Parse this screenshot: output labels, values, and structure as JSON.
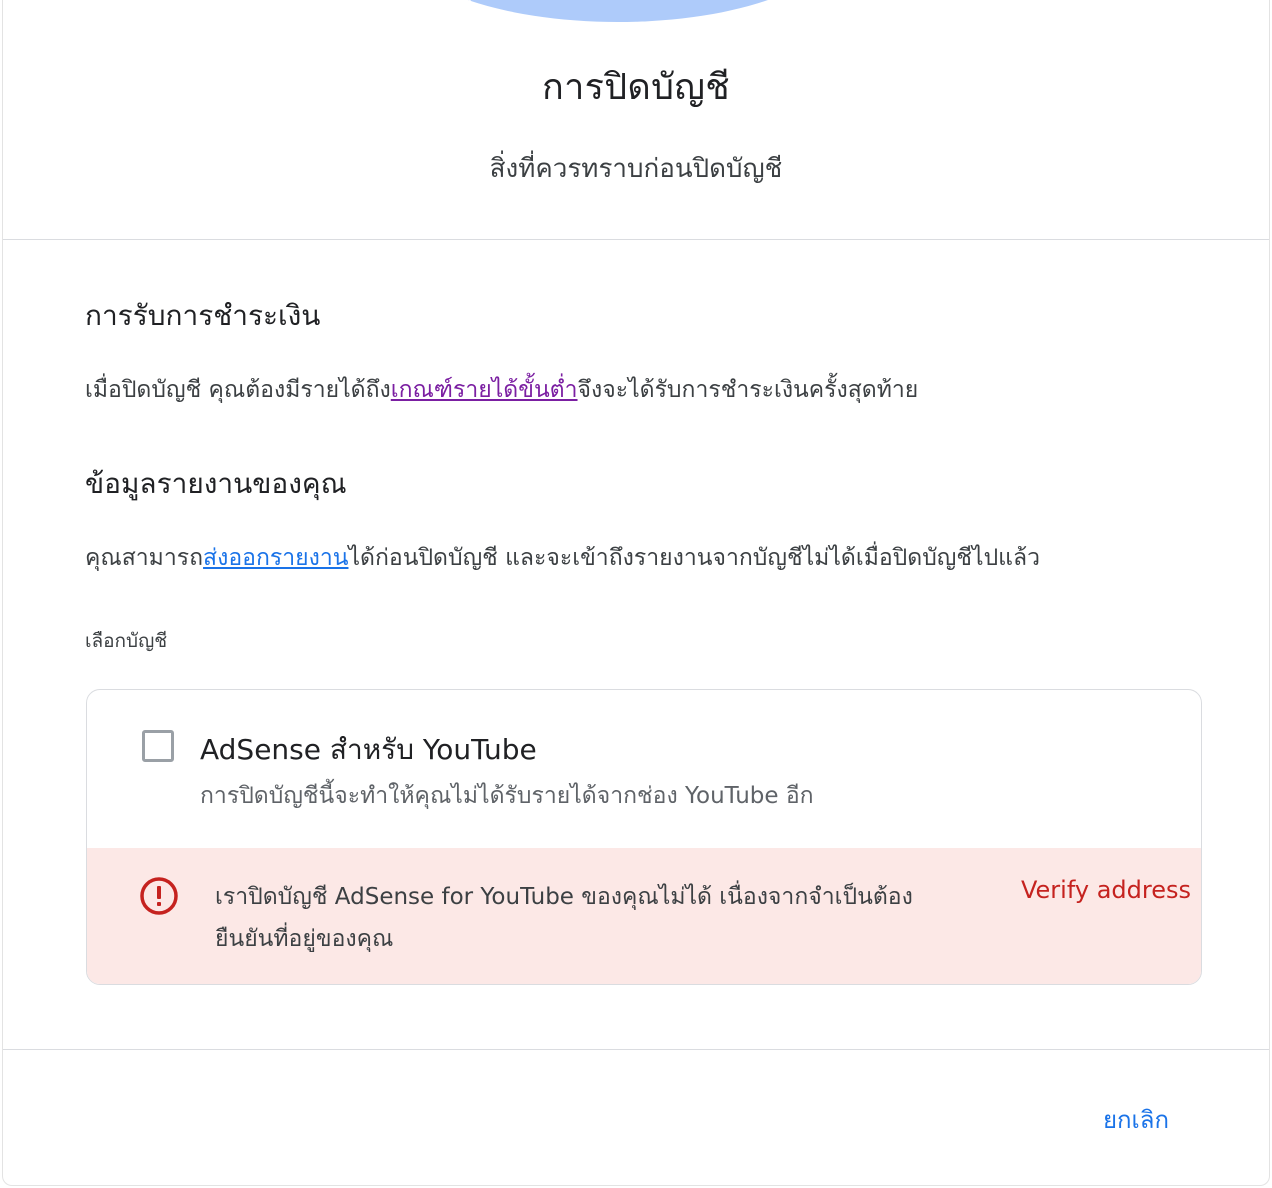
{
  "dialog": {
    "title": "การปิดบัญชี",
    "subtitle": "สิ่งที่ควรทราบก่อนปิดบัญชี"
  },
  "payments": {
    "heading": "การรับการชำระเงิน",
    "text_before": "เมื่อปิดบัญชี คุณต้องมีรายได้ถึง",
    "link": "เกณฑ์รายได้ขั้นต่ำ",
    "text_after": "จึงจะได้รับการชำระเงินครั้งสุดท้าย"
  },
  "reports": {
    "heading": "ข้อมูลรายงานของคุณ",
    "text_before": "คุณสามารถ",
    "link": "ส่งออกรายงาน",
    "text_after": "ได้ก่อนปิดบัญชี และจะเข้าถึงรายงานจากบัญชีไม่ได้เมื่อปิดบัญชีไปแล้ว"
  },
  "account_select": {
    "label": "เลือกบัญชี",
    "account_name": "AdSense สำหรับ YouTube",
    "account_desc": "การปิดบัญชีนี้จะทำให้คุณไม่ได้รับรายได้จากช่อง YouTube อีก",
    "checked": false,
    "error": {
      "icon": "error-icon",
      "text": "เราปิดบัญชี AdSense for YouTube ของคุณไม่ได้ เนื่องจากจำเป็นต้องยืนยันที่อยู่ของคุณ",
      "action": "Verify address",
      "color": "#c5221f",
      "background": "#fce8e6"
    }
  },
  "footer": {
    "cancel_label": "ยกเลิก"
  },
  "colors": {
    "accent": "#1a73e8",
    "visited_link": "#7b1fa2",
    "illustration": "#aecbfa"
  }
}
